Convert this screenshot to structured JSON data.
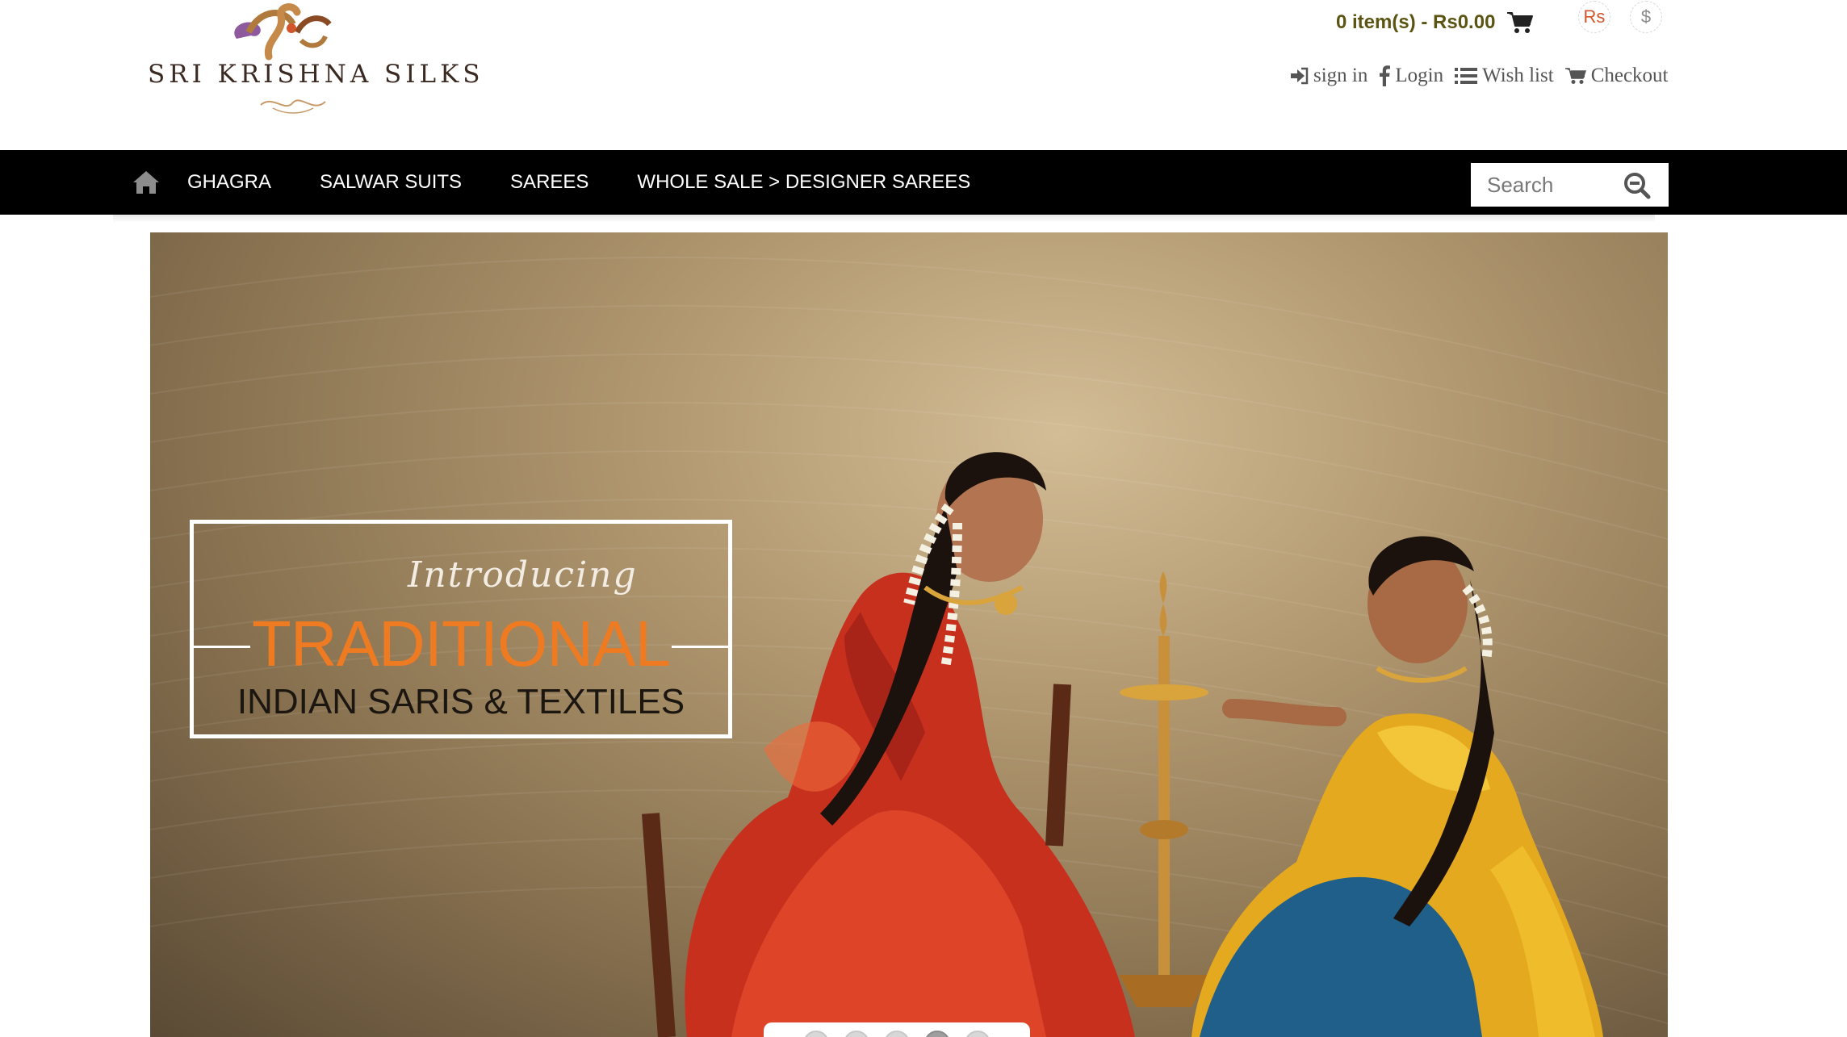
{
  "brand": {
    "name": "SRI KRISHNA SILKS"
  },
  "cart": {
    "summary": "0 item(s) - Rs0.00"
  },
  "currency": {
    "options": [
      "Rs",
      "$"
    ],
    "selected": "Rs"
  },
  "account_links": [
    {
      "label": "sign in",
      "icon": "sign-in-icon"
    },
    {
      "label": "Login",
      "icon": "facebook-icon"
    },
    {
      "label": "Wish list",
      "icon": "list-icon"
    },
    {
      "label": "Checkout",
      "icon": "cart-icon"
    }
  ],
  "nav": {
    "items": [
      "GHAGRA",
      "SALWAR SUITS",
      "SAREES",
      "WHOLE SALE > DESIGNER SAREES"
    ]
  },
  "search": {
    "placeholder": "Search"
  },
  "hero": {
    "intro": "Introducing",
    "headline": "TRADITIONAL",
    "subline": "INDIAN SARIS & TEXTILES",
    "slides": 5,
    "active_slide": 4
  },
  "colors": {
    "nav_background": "#000000",
    "headline_orange": "#ee7a22",
    "cart_text": "#5b5412",
    "rs_currency": "#d2552b"
  }
}
